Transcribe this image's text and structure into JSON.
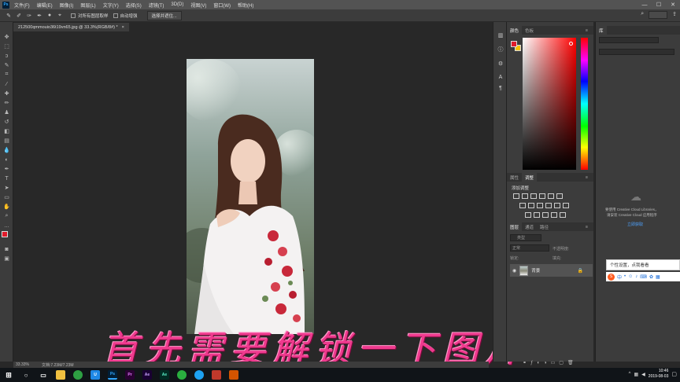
{
  "menubar": {
    "items": [
      "文件(F)",
      "编辑(E)",
      "图像(I)",
      "图层(L)",
      "文字(Y)",
      "选择(S)",
      "滤镜(T)",
      "3D(D)",
      "视图(V)",
      "窗口(W)",
      "帮助(H)"
    ]
  },
  "options": {
    "sample_all_label": "对所有图层取样",
    "auto_enhance_label": "自动增强",
    "select_subject_label": "选择并遮住..."
  },
  "document": {
    "tab_title": "212500qmmouio36t19vn65.jpg @ 33.3%(RGB/8#) *",
    "close": "×"
  },
  "status": {
    "zoom": "33.33%",
    "doc_info": "文档:7.23M/7.23M"
  },
  "caption": "首先需要解锁一下图片",
  "panels": {
    "color_tabs": [
      "颜色",
      "色板"
    ],
    "adjust_tabs": [
      "属性",
      "调整"
    ],
    "adjust_title": "添加调整",
    "layers_tabs": [
      "图层",
      "通道",
      "路径"
    ],
    "kind_label": "类型",
    "blend_mode": "正常",
    "opacity_label": "不透明度:",
    "lock_label": "锁定:",
    "fill_label": "填充:",
    "layer_name": "背景"
  },
  "libraries": {
    "tab": "库",
    "line1": "要使用 Creative Cloud Libraries，",
    "line2": "请安装 Creative Cloud 应用程序",
    "link": "立即获取"
  },
  "ime": {
    "popup_text": "个性设置，点我看看",
    "lang": "中"
  },
  "taskbar": {
    "time": "10:46",
    "date": "2019-08-03"
  },
  "colors": {
    "foreground": "#e01b2b",
    "background": "#f5c300",
    "caption": "#ef3a8e"
  }
}
